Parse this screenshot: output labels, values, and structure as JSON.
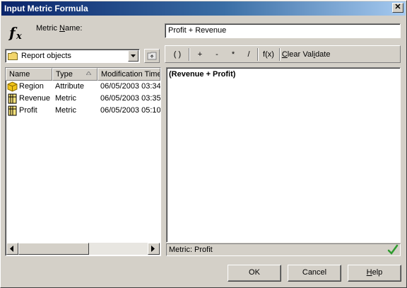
{
  "window": {
    "title": "Input Metric Formula",
    "close_glyph": "✕"
  },
  "metric_name": {
    "label_pre": "Metric ",
    "label_accel": "N",
    "label_post": "ame:",
    "value": "Profit + Revenue"
  },
  "object_browser": {
    "selected": "Report objects",
    "columns": [
      "Name",
      "Type",
      "Modification Time"
    ],
    "rows": [
      {
        "name": "Region",
        "type": "Attribute",
        "modified": "06/05/2003 03:34",
        "icon": "attribute-icon"
      },
      {
        "name": "Revenue",
        "type": "Metric",
        "modified": "06/05/2003 03:35",
        "icon": "metric-icon"
      },
      {
        "name": "Profit",
        "type": "Metric",
        "modified": "06/05/2003 05:10",
        "icon": "metric-icon"
      }
    ]
  },
  "toolbar": {
    "parens": "( )",
    "plus": "+",
    "minus": "-",
    "multiply": "*",
    "divide": "/",
    "function": "f(x)",
    "clear_accel": "C",
    "clear_rest": "lear",
    "validate_pre": "Val",
    "validate_accel": "i",
    "validate_post": "date"
  },
  "formula": {
    "text": "(Revenue + Profit)"
  },
  "status": {
    "text": "Metric: Profit",
    "valid": true
  },
  "buttons": {
    "ok": "OK",
    "cancel": "Cancel",
    "help_accel": "H",
    "help_rest": "elp"
  },
  "colors": {
    "title_start": "#0a246a",
    "title_end": "#a6caf0",
    "face": "#d4d0c8",
    "check_green": "#2e9b2e"
  }
}
